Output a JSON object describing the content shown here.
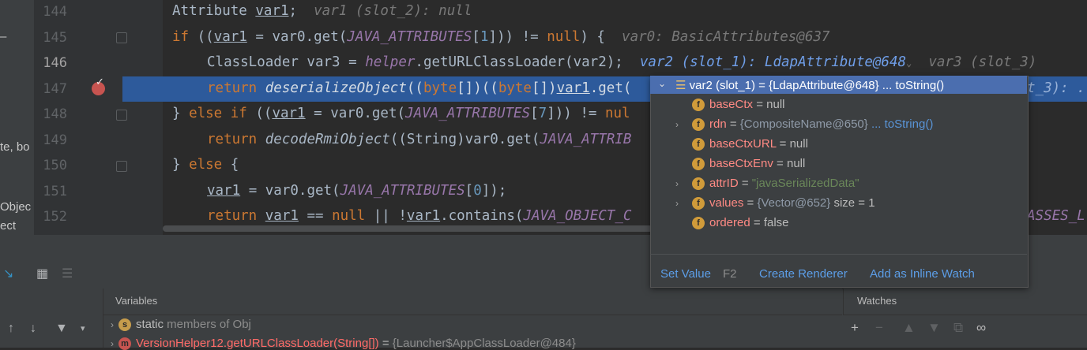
{
  "left_strip": {
    "frag1": "te, bo",
    "frag2": "Objec",
    "frag3": "ect"
  },
  "gutter": {
    "lines": [
      "144",
      "145",
      "146",
      "147",
      "148",
      "149",
      "150",
      "151",
      "152"
    ]
  },
  "code": {
    "l144": {
      "t1": "Attribute ",
      "v": "var1",
      "t2": ";",
      "inline": "var1 (slot_2): null"
    },
    "l145": {
      "kw": "if",
      "t1": " ((",
      "v": "var1",
      "t2": " = var0.get(",
      "c": "JAVA_ATTRIBUTES",
      "t3": "[",
      "n": "1",
      "t4": "])) != ",
      "kw2": "null",
      "t5": ") {",
      "inline": "var0: BasicAttributes@637"
    },
    "l146": {
      "t1": "ClassLoader var3 = ",
      "h": "helper",
      "t2": ".getURLClassLoader(var2);",
      "inline": "var2 (slot_1): LdapAttribute@648",
      "inline2": "var3 (slot_3)"
    },
    "l147": {
      "kw": "return ",
      "f": "deserializeObject",
      "t1": "((",
      "kw2": "byte",
      "t2": "[])((",
      "kw3": "byte",
      "t3": "[])",
      "v": "var1",
      "t4": ".get(",
      "inline": "t_3): ..."
    },
    "l148": {
      "t1": "} ",
      "kw": "else if",
      "t2": " ((",
      "v": "var1",
      "t3": " = var0.get(",
      "c": "JAVA_ATTRIBUTES",
      "t4": "[",
      "n": "7",
      "t5": "])) != ",
      "kw2": "nul"
    },
    "l149": {
      "kw": "return ",
      "f": "decodeRmiObject",
      "t1": "((String)var0.get(",
      "c": "JAVA_ATTRIB"
    },
    "l150": {
      "t1": "} ",
      "kw": "else",
      "t2": " {"
    },
    "l151": {
      "v": "var1",
      "t1": " = var0.get(",
      "c": "JAVA_ATTRIBUTES",
      "t2": "[",
      "n": "0",
      "t3": "]);"
    },
    "l152": {
      "kw": "return ",
      "v": "var1",
      "t1": " == ",
      "kw2": "null",
      "t2": " || !",
      "v2": "var1",
      "t3": ".contains(",
      "c": "JAVA_OBJECT_C",
      "c2": "ASSES_L"
    }
  },
  "popup": {
    "root": {
      "name": "var2 (slot_1)",
      "eq": " = ",
      "val": "{LdapAttribute@648}",
      "link": "... toString()"
    },
    "fields": [
      {
        "name": "baseCtx",
        "eq": " = ",
        "val": "null",
        "type": "plain",
        "expandable": false
      },
      {
        "name": "rdn",
        "eq": " = ",
        "val": "{CompositeName@650}",
        "link": "... toString()",
        "type": "object",
        "expandable": true
      },
      {
        "name": "baseCtxURL",
        "eq": " = ",
        "val": "null",
        "type": "plain",
        "expandable": false
      },
      {
        "name": "baseCtxEnv",
        "eq": " = ",
        "val": "null",
        "type": "plain",
        "expandable": false
      },
      {
        "name": "attrID",
        "eq": " = ",
        "val": "\"javaSerializedData\"",
        "type": "string",
        "expandable": true
      },
      {
        "name": "values",
        "eq": " = ",
        "val": "{Vector@652}",
        "extra": "size = 1",
        "type": "object",
        "expandable": true
      },
      {
        "name": "ordered",
        "eq": " = ",
        "val": "false",
        "type": "plain",
        "expandable": false
      }
    ],
    "actions": {
      "set_value": "Set Value",
      "set_value_key": "F2",
      "create_renderer": "Create Renderer",
      "add_watch": "Add as Inline Watch"
    }
  },
  "panel": {
    "variables_title": "Variables",
    "watches_title": "Watches",
    "row1": {
      "badge": "s",
      "label": "static",
      "rest": " members of Obj"
    },
    "row2": {
      "badge": "m",
      "label": "VersionHelper12.getURLClassLoader(String[])",
      "eq": " = ",
      "val": "{Launcher$AppClassLoader@484}"
    }
  },
  "colors": {
    "background": "#2b2b2b",
    "selection": "#2d5a9b",
    "keyword": "#cc7832",
    "constant": "#9876aa",
    "popup_selection": "#4b6eaf",
    "link": "#5994d6"
  },
  "icons": [
    "breakpoint-icon",
    "fold-icon",
    "field-badge-icon",
    "watch-add-icon",
    "glasses-icon",
    "table-icon",
    "step-icon"
  ]
}
